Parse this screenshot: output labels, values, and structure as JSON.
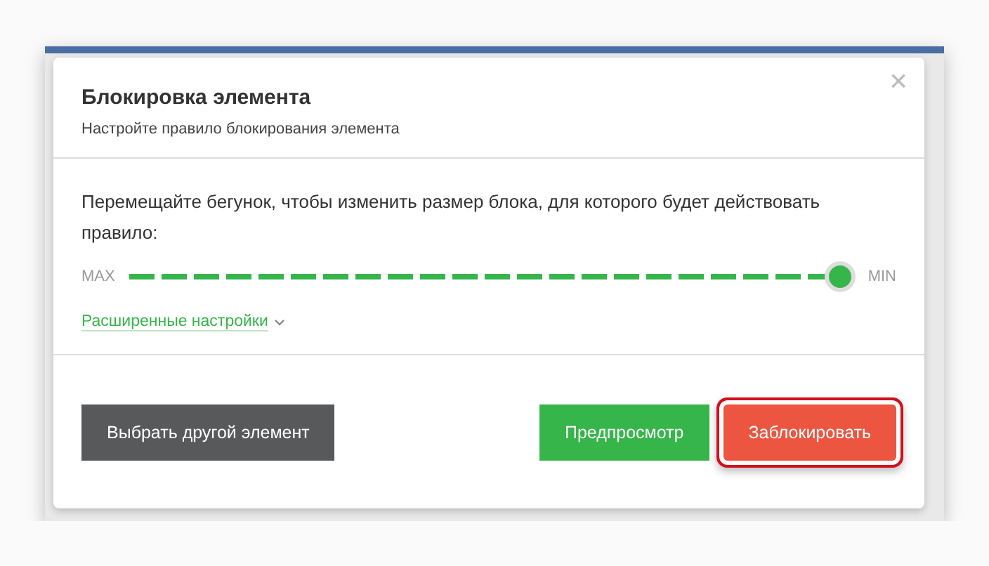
{
  "dialog": {
    "title": "Блокировка элемента",
    "subtitle": "Настройте правило блокирования элемента",
    "close": "×"
  },
  "body": {
    "instruction": "Перемещайте бегунок, чтобы изменить размер блока, для которого будет действовать правило:",
    "slider": {
      "min_label": "MAX",
      "max_label": "MIN",
      "level": 1
    },
    "advanced_link": "Расширенные настройки"
  },
  "buttons": [
    {
      "label": "Выбрать другой элемент",
      "kind": "secondary",
      "highlighted": false
    },
    {
      "label": "Предпросмотр",
      "kind": "preview",
      "highlighted": false
    },
    {
      "label": "Заблокировать",
      "kind": "danger",
      "highlighted": true
    }
  ]
}
